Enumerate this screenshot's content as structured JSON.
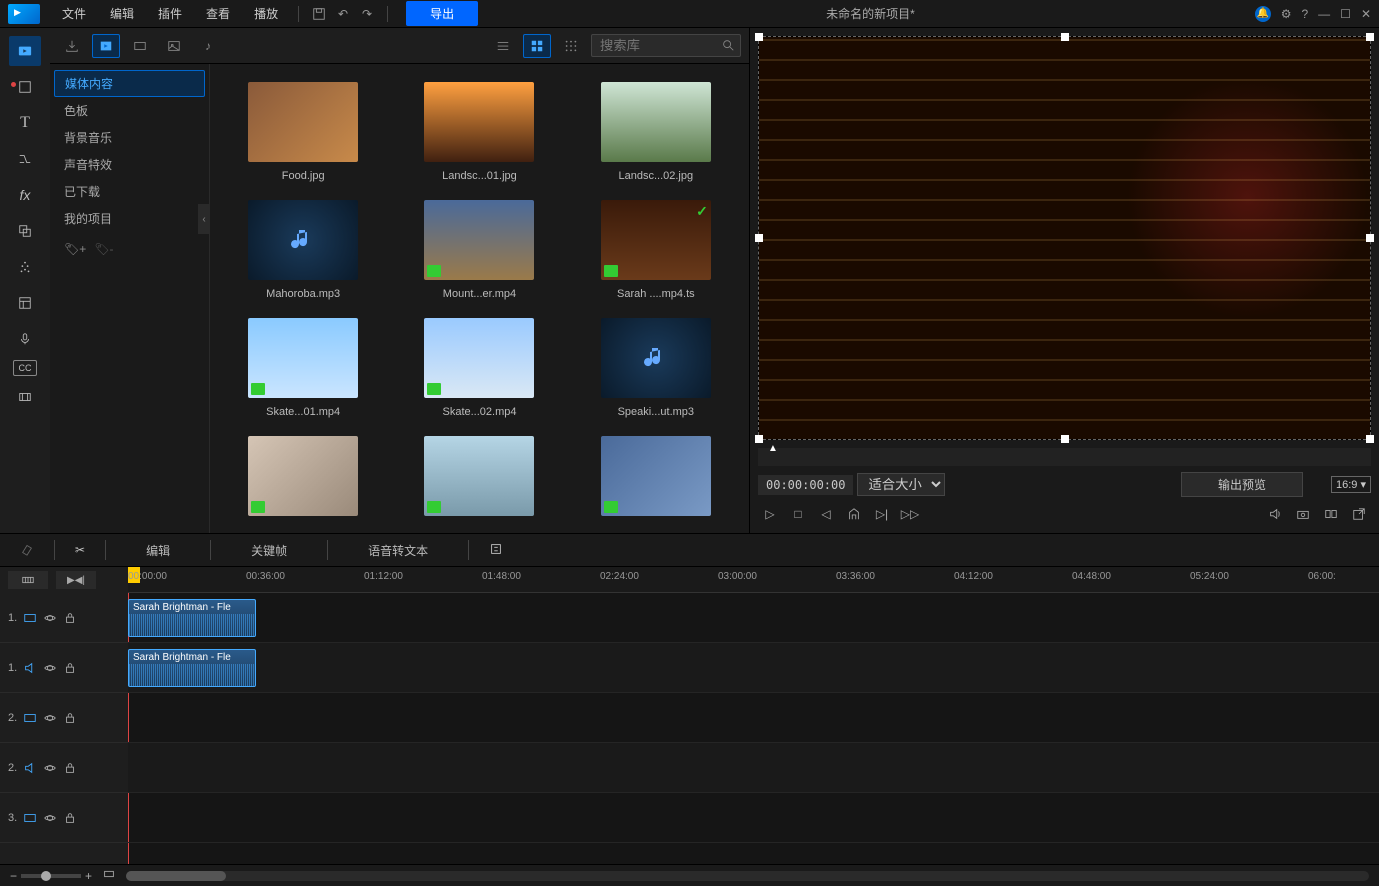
{
  "menubar": {
    "file": "文件",
    "edit": "编辑",
    "plugin": "插件",
    "view": "查看",
    "play": "播放",
    "export": "导出",
    "title": "未命名的新项目*"
  },
  "library": {
    "search_placeholder": "搜索库",
    "sidebar": [
      "媒体内容",
      "色板",
      "背景音乐",
      "声音特效",
      "已下载",
      "我的项目"
    ],
    "items": [
      {
        "label": "Food.jpg",
        "kind": "img",
        "bg": "linear-gradient(135deg,#8a5a3a,#c88a4a)"
      },
      {
        "label": "Landsc...01.jpg",
        "kind": "img",
        "bg": "linear-gradient(180deg,#ffa040,#402010)"
      },
      {
        "label": "Landsc...02.jpg",
        "kind": "img",
        "bg": "linear-gradient(180deg,#cfe5d5,#5a7a4a)"
      },
      {
        "label": "Mahoroba.mp3",
        "kind": "aud"
      },
      {
        "label": "Mount...er.mp4",
        "kind": "vid",
        "bg": "linear-gradient(180deg,#4a6a9a,#9a7a4a)"
      },
      {
        "label": "Sarah ....mp4.ts",
        "kind": "vid",
        "bg": "linear-gradient(180deg,#3a1a0a,#6a3a1a)",
        "check": true
      },
      {
        "label": "Skate...01.mp4",
        "kind": "vid",
        "bg": "linear-gradient(180deg,#8acaff,#cae5ff)"
      },
      {
        "label": "Skate...02.mp4",
        "kind": "vid",
        "bg": "linear-gradient(180deg,#9acaff,#dae8f5)"
      },
      {
        "label": "Speaki...ut.mp3",
        "kind": "aud"
      },
      {
        "label": "",
        "kind": "vid",
        "bg": "linear-gradient(135deg,#d5c5b5,#9a8a7a)"
      },
      {
        "label": "",
        "kind": "vid",
        "bg": "linear-gradient(180deg,#b5d5e5,#7a9aaa)"
      },
      {
        "label": "",
        "kind": "vid",
        "bg": "linear-gradient(135deg,#4a6a9a,#7a9ac5)"
      }
    ]
  },
  "preview": {
    "timecode": "00:00:00:00",
    "fit": "适合大小",
    "output": "输出预览",
    "ratio": "16:9"
  },
  "toolrow": {
    "edit": "编辑",
    "keyframe": "关键帧",
    "speech": "语音转文本"
  },
  "timeline": {
    "marks": [
      "00:00:00",
      "00:36:00",
      "01:12:00",
      "01:48:00",
      "02:24:00",
      "03:00:00",
      "03:36:00",
      "04:12:00",
      "04:48:00",
      "05:24:00",
      "06:00:"
    ],
    "tracks": [
      {
        "n": "1.",
        "type": "video"
      },
      {
        "n": "1.",
        "type": "audio"
      },
      {
        "n": "2.",
        "type": "video"
      },
      {
        "n": "2.",
        "type": "audio"
      },
      {
        "n": "3.",
        "type": "video"
      }
    ],
    "clip_label": "Sarah Brightman - Fle"
  }
}
